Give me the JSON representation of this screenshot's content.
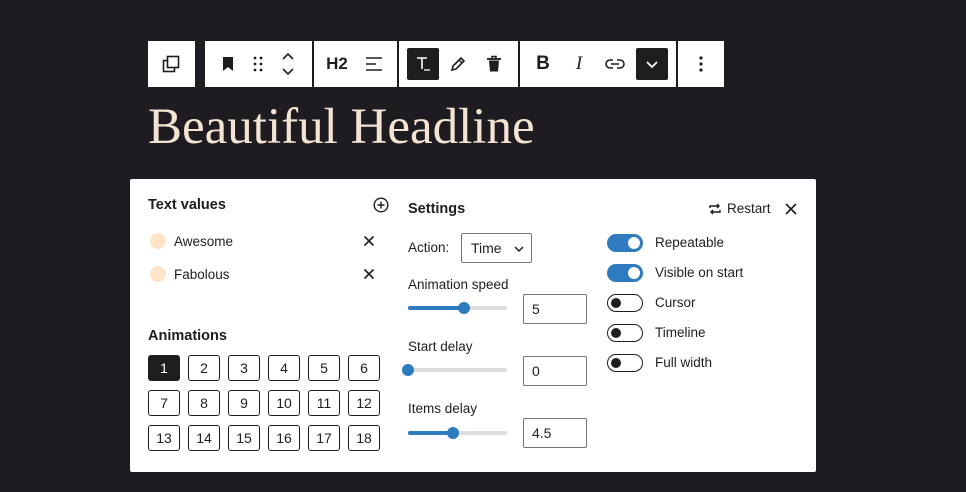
{
  "toolbar": {
    "transform_icon": "duplicate-icon",
    "bookmark_icon": "bookmark-icon",
    "drag_icon": "drag-handle-icon",
    "move_icon": "move-up-down-icon",
    "heading_level": "H2",
    "align_icon": "align-left-icon",
    "text_color_icon": "text-color-icon",
    "pencil_icon": "pencil-icon",
    "trash_icon": "trash-icon",
    "bold_label": "B",
    "italic_label": "I",
    "link_icon": "link-icon",
    "more_rich_text_icon": "chevron-down-icon",
    "options_icon": "more-vertical-icon"
  },
  "headline": "Beautiful Headline",
  "panel": {
    "text_values": {
      "heading": "Text values",
      "items": [
        {
          "label": "Awesome",
          "color": "#fce3c9"
        },
        {
          "label": "Fabolous",
          "color": "#fce3c9"
        }
      ]
    },
    "animations": {
      "heading": "Animations",
      "options": [
        "1",
        "2",
        "3",
        "4",
        "5",
        "6",
        "7",
        "8",
        "9",
        "10",
        "11",
        "12",
        "13",
        "14",
        "15",
        "16",
        "17",
        "18"
      ],
      "selected": "1"
    },
    "settings": {
      "heading": "Settings",
      "restart_label": "Restart",
      "action_label": "Action:",
      "action_value": "Time",
      "animation_speed_label": "Animation speed",
      "animation_speed_value": "5",
      "animation_speed_fraction": 0.57,
      "start_delay_label": "Start delay",
      "start_delay_value": "0",
      "start_delay_fraction": 0.0,
      "items_delay_label": "Items delay",
      "items_delay_value": "4.5",
      "items_delay_fraction": 0.45
    },
    "toggles": [
      {
        "label": "Repeatable",
        "on": true
      },
      {
        "label": "Visible on start",
        "on": true
      },
      {
        "label": "Cursor",
        "on": false
      },
      {
        "label": "Timeline",
        "on": false
      },
      {
        "label": "Full width",
        "on": false
      }
    ]
  },
  "colors": {
    "background": "#1e1c20",
    "headline": "#f3e3d3",
    "accent": "#2e7cbf",
    "swatch": "#fce3c9"
  }
}
